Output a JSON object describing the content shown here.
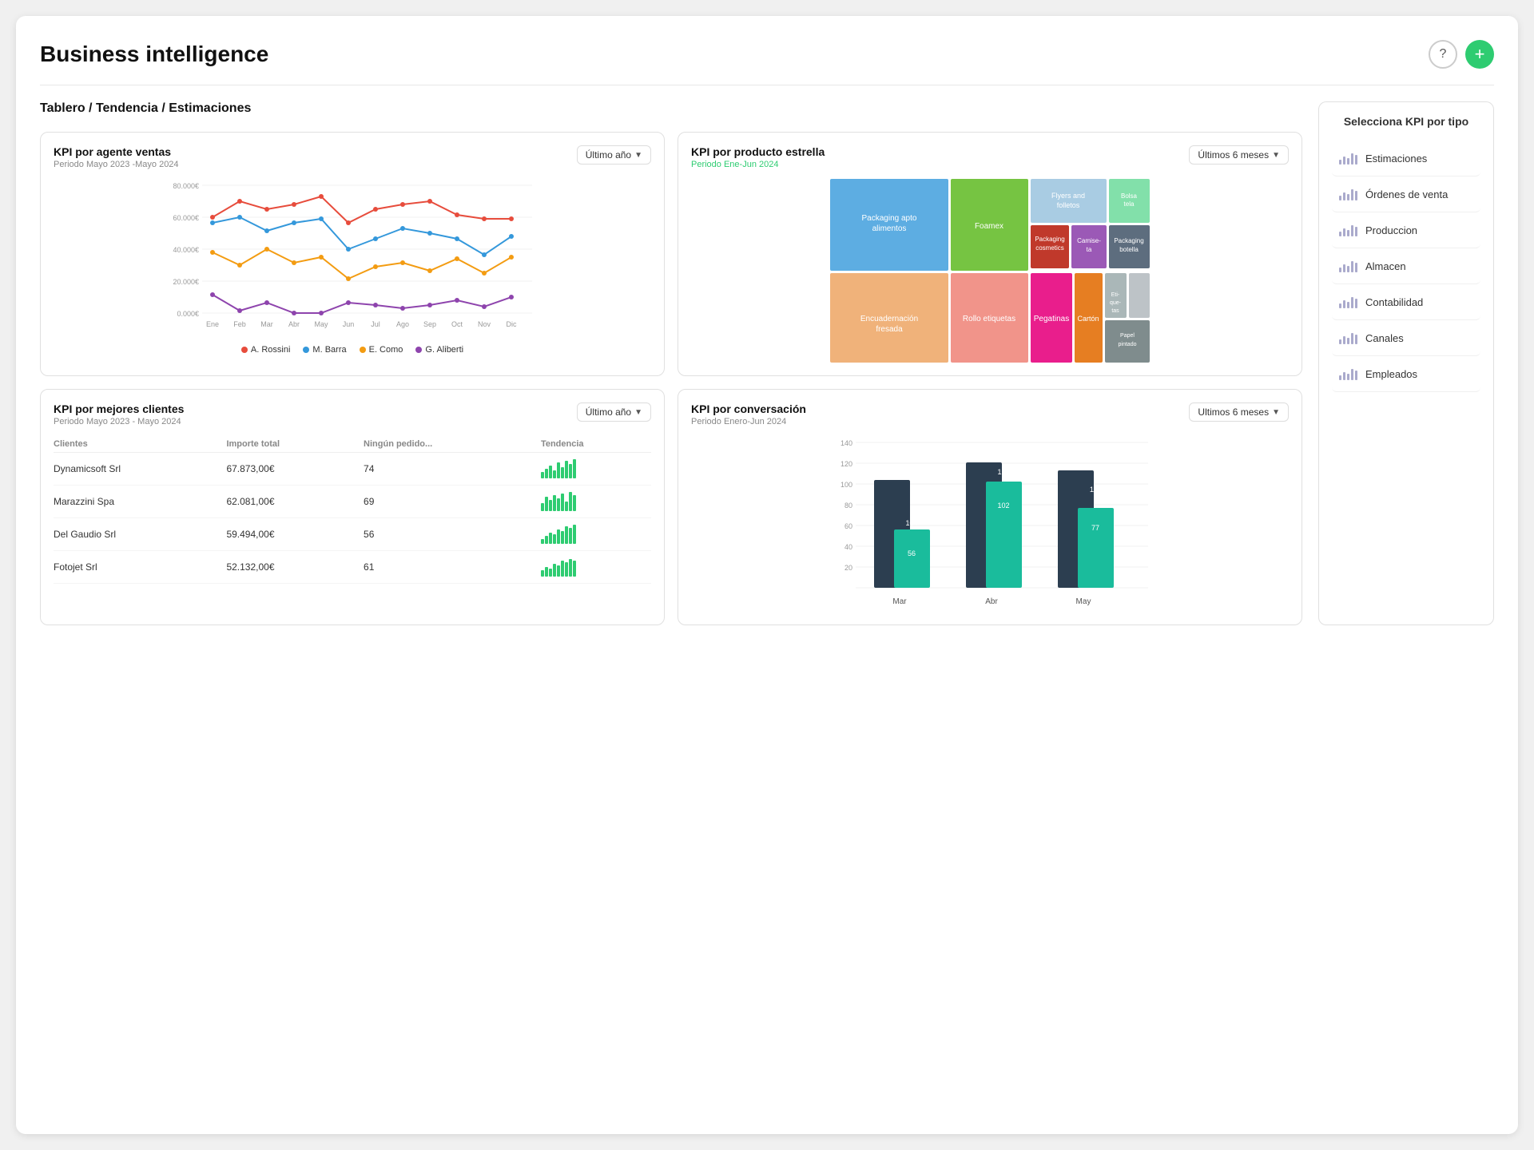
{
  "header": {
    "title": "Business intelligence",
    "help_label": "?",
    "add_label": "+"
  },
  "breadcrumb": "Tablero / Tendencia / Estimaciones",
  "charts": {
    "kpi_agente": {
      "title": "KPI por agente ventas",
      "subtitle": "Periodo  Mayo 2023 -Mayo 2024",
      "dropdown": "Último año",
      "y_labels": [
        "80.000€",
        "60.000€",
        "40.000€",
        "20.000€",
        "0.000€"
      ],
      "x_labels": [
        "Ene",
        "Feb",
        "Mar",
        "Abr",
        "May",
        "Jun",
        "Jul",
        "Ago",
        "Sep",
        "Oct",
        "Nov",
        "Dic"
      ],
      "legend": [
        {
          "name": "A. Rossini",
          "color": "#e74c3c"
        },
        {
          "name": "M. Barra",
          "color": "#3498db"
        },
        {
          "name": "E. Como",
          "color": "#f39c12"
        },
        {
          "name": "G. Aliberti",
          "color": "#8e44ad"
        }
      ]
    },
    "kpi_producto": {
      "title": "KPI por producto estrella",
      "subtitle": "Periodo Ene-Jun 2024",
      "dropdown": "Últimos 6 meses",
      "cells": [
        {
          "label": "Packaging apto alimentos",
          "color": "#5dade2",
          "size": "large"
        },
        {
          "label": "Foamex",
          "color": "#76c442",
          "size": "medium"
        },
        {
          "label": "Flyers and folletos",
          "color": "#a9cce3",
          "size": "medium-sm"
        },
        {
          "label": "Bolsa tela",
          "color": "#82e0aa",
          "size": "small"
        },
        {
          "label": "Packaging cosmetics",
          "color": "#c0392b",
          "size": "small"
        },
        {
          "label": "Camise-ta",
          "color": "#a569bd",
          "size": "small"
        },
        {
          "label": "Packaging botella",
          "color": "#5d6d7e",
          "size": "small"
        },
        {
          "label": "Encuadernación fresada",
          "color": "#f0b27a",
          "size": "large-bottom"
        },
        {
          "label": "Rollo etiquetas",
          "color": "#f1948a",
          "size": "medium-bottom"
        },
        {
          "label": "Pegatinas",
          "color": "#f06292",
          "size": "small-bottom"
        },
        {
          "label": "Cartón",
          "color": "#e67e22",
          "size": "small-bottom"
        },
        {
          "label": "Eti-que-tas",
          "color": "#aab7b8",
          "size": "tiny"
        },
        {
          "label": "Papel pintado",
          "color": "#7f8c8d",
          "size": "tiny"
        }
      ]
    },
    "kpi_clientes": {
      "title": "KPI por mejores clientes",
      "subtitle": "Periodo Mayo  2023 - Mayo  2024",
      "dropdown": "Último año",
      "columns": [
        "Clientes",
        "Importe total",
        "Ningún pedido...",
        "Tendencia"
      ],
      "rows": [
        {
          "client": "Dynamicsoft Srl",
          "amount": "67.873,00€",
          "orders": "74"
        },
        {
          "client": "Marazzini Spa",
          "amount": "62.081,00€",
          "orders": "69"
        },
        {
          "client": "Del Gaudio Srl",
          "amount": "59.494,00€",
          "orders": "56"
        },
        {
          "client": "Fotojet Srl",
          "amount": "52.132,00€",
          "orders": "61"
        }
      ]
    },
    "kpi_conversacion": {
      "title": "KPI por conversación",
      "subtitle": "Periodo Enero-Jun 2024",
      "dropdown": "Ultimos 6 meses",
      "y_max": 140,
      "months": [
        "Mar",
        "Abr",
        "May"
      ],
      "bars": [
        {
          "month": "Mar",
          "val1": 56,
          "val2": 104,
          "color1": "#2c3e50",
          "color2": "#1abc9c"
        },
        {
          "month": "Abr",
          "val1": 102,
          "val2": 121,
          "color1": "#2c3e50",
          "color2": "#1abc9c"
        },
        {
          "month": "May",
          "val1": 77,
          "val2": 113,
          "color1": "#2c3e50",
          "color2": "#1abc9c"
        }
      ],
      "y_labels": [
        "140",
        "120",
        "100",
        "80",
        "60",
        "40",
        "20",
        ""
      ]
    }
  },
  "sidebar": {
    "title": "Selecciona KPI por tipo",
    "items": [
      {
        "label": "Estimaciones"
      },
      {
        "label": "Órdenes de venta"
      },
      {
        "label": "Produccion"
      },
      {
        "label": "Almacen"
      },
      {
        "label": "Contabilidad"
      },
      {
        "label": "Canales"
      },
      {
        "label": "Empleados"
      }
    ]
  }
}
